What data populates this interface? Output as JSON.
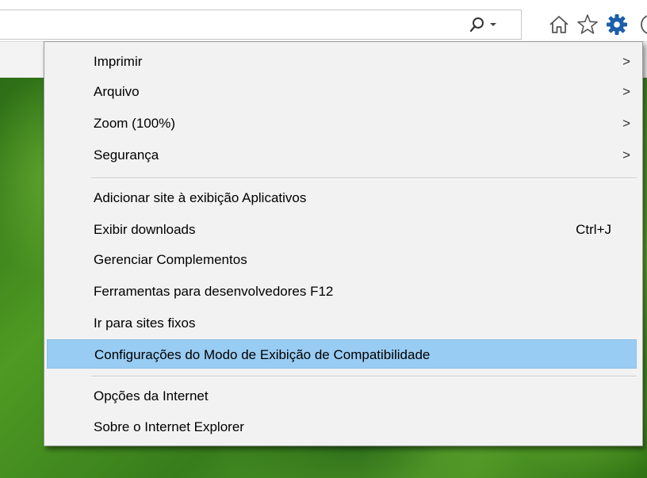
{
  "toolbar": {
    "search_icon": "search-icon",
    "dropdown_icon": "chevron-down-icon",
    "icons": [
      "home-icon",
      "favorites-star-icon",
      "gear-icon"
    ]
  },
  "colors": {
    "menu_bg": "#f2f2f2",
    "highlight": "#99ccf2",
    "gear_blue": "#1d5fa8",
    "page_green": "#3f8a1e"
  },
  "menu": {
    "items": [
      {
        "label": "Imprimir",
        "submenu": ">"
      },
      {
        "label": "Arquivo",
        "submenu": ">"
      },
      {
        "label": "Zoom (100%)",
        "submenu": ">"
      },
      {
        "label": "Segurança",
        "submenu": ">"
      },
      {
        "label": "Adicionar site à exibição Aplicativos"
      },
      {
        "label": "Exibir downloads",
        "shortcut": "Ctrl+J"
      },
      {
        "label": "Gerenciar Complementos"
      },
      {
        "label": "Ferramentas para desenvolvedores F12"
      },
      {
        "label": "Ir para sites fixos"
      },
      {
        "label": "Configurações do Modo de Exibição de Compatibilidade",
        "highlighted": true
      },
      {
        "label": "Opções da Internet"
      },
      {
        "label": "Sobre o Internet Explorer"
      }
    ]
  }
}
